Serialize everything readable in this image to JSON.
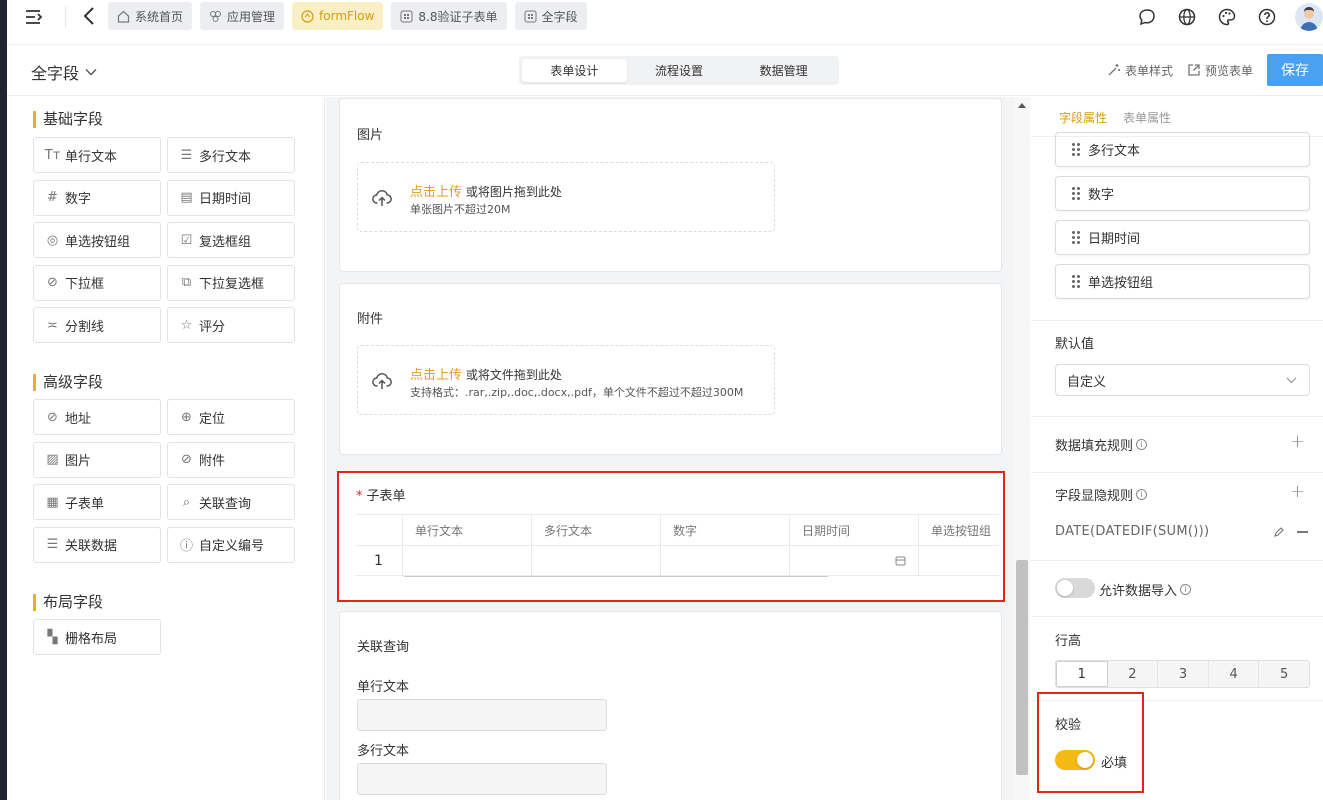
{
  "topbar": {
    "tabs": [
      {
        "label": "系统首页",
        "icon": "home-icon"
      },
      {
        "label": "应用管理",
        "icon": "apps-icon"
      },
      {
        "label": "formFlow",
        "icon": "flow-icon",
        "active": true
      },
      {
        "label": "8.8验证子表单",
        "icon": "grid-icon"
      },
      {
        "label": "全字段",
        "icon": "grid-icon"
      }
    ],
    "right_icons": [
      "chat-icon",
      "globe-icon",
      "palette-icon",
      "help-icon",
      "user-avatar"
    ]
  },
  "header": {
    "title": "全字段",
    "segments": [
      "表单设计",
      "流程设置",
      "数据管理"
    ],
    "active_segment": "表单设计",
    "style_action": "表单样式",
    "preview_action": "预览表单",
    "save_label": "保存"
  },
  "left": {
    "basic_title": "基础字段",
    "basic": [
      {
        "label": "单行文本",
        "icon": "Tт"
      },
      {
        "label": "多行文本",
        "icon": "☰"
      },
      {
        "label": "数字",
        "icon": "#"
      },
      {
        "label": "日期时间",
        "icon": "▤"
      },
      {
        "label": "单选按钮组",
        "icon": "◎"
      },
      {
        "label": "复选框组",
        "icon": "☑"
      },
      {
        "label": "下拉框",
        "icon": "⊘"
      },
      {
        "label": "下拉复选框",
        "icon": "⧉"
      },
      {
        "label": "分割线",
        "icon": "≍"
      },
      {
        "label": "评分",
        "icon": "☆"
      }
    ],
    "advanced_title": "高级字段",
    "advanced": [
      {
        "label": "地址",
        "icon": "⊘"
      },
      {
        "label": "定位",
        "icon": "⊕"
      },
      {
        "label": "图片",
        "icon": "▨"
      },
      {
        "label": "附件",
        "icon": "⊘"
      },
      {
        "label": "子表单",
        "icon": "▦"
      },
      {
        "label": "关联查询",
        "icon": "⌕"
      },
      {
        "label": "关联数据",
        "icon": "☰"
      },
      {
        "label": "自定义编号",
        "icon": "ⓘ"
      }
    ],
    "layout_title": "布局字段",
    "layout": [
      {
        "label": "栅格布局",
        "icon": "▚"
      }
    ]
  },
  "canvas": {
    "image_card": {
      "label": "图片",
      "upload_link": "点击上传",
      "upload_text": "或将图片拖到此处",
      "hint": "单张图片不超过20M"
    },
    "attach_card": {
      "label": "附件",
      "upload_link": "点击上传",
      "upload_text": "或将文件拖到此处",
      "hint": "支持格式：.rar,.zip,.doc,.docx,.pdf，单个文件不超过不超过300M"
    },
    "subform": {
      "required_mark": "*",
      "label": "子表单",
      "columns": [
        "单行文本",
        "多行文本",
        "数字",
        "日期时间",
        "单选按钮组"
      ],
      "row_index": "1"
    },
    "lookup_card": {
      "label": "关联查询",
      "field1": "单行文本",
      "field2": "多行文本"
    }
  },
  "right": {
    "tabs": [
      "字段属性",
      "表单属性"
    ],
    "active_tab": "字段属性",
    "sort_items": [
      "多行文本",
      "数字",
      "日期时间",
      "单选按钮组"
    ],
    "default_label": "默认值",
    "default_value": "自定义",
    "fill_rule_label": "数据填充规则",
    "visibility_label": "字段显隐规则",
    "formula": "DATE(DATEDIF(SUM()))",
    "import_label": "允许数据导入",
    "import_enabled": false,
    "row_height_label": "行高",
    "row_heights": [
      "1",
      "2",
      "3",
      "4",
      "5"
    ],
    "row_height_selected": "1",
    "validate_label": "校验",
    "required_label": "必填",
    "required_enabled": true
  },
  "colors": {
    "accent": "#e6b325",
    "save": "#4aa1f3",
    "highlight": "#e5231b",
    "toggle_on": "#f5b914",
    "toggle_off": "#d9d9d9"
  }
}
